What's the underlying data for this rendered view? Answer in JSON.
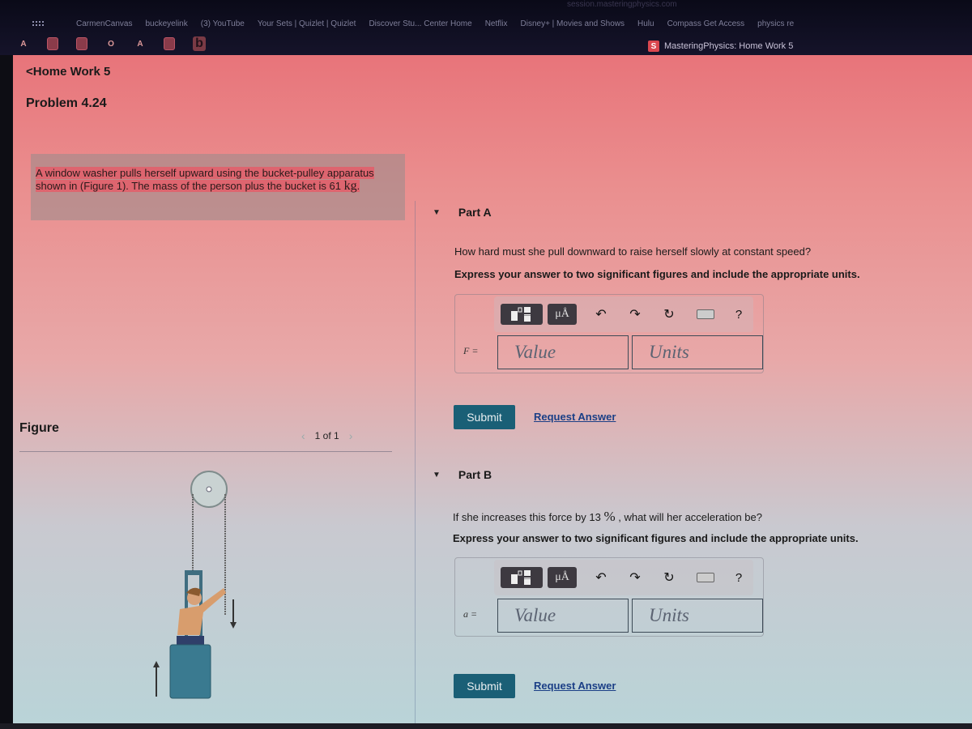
{
  "browser": {
    "url_partial": "session.masteringphysics.com",
    "bookmarks": [
      "CarmenCanvas",
      "buckeyelink",
      "(3) YouTube",
      "Your Sets | Quizlet | Quizlet",
      "Discover Stu... Center Home",
      "Netflix",
      "Disney+ | Movies and Shows",
      "Hulu",
      "Compass Get Access",
      "physics re"
    ],
    "pinned_tabs": [
      "A",
      "",
      "",
      "O",
      "A",
      "",
      "b"
    ],
    "active_tab_title": "MasteringPhysics: Home Work 5",
    "active_tab_icon": "mastering-logo"
  },
  "nav": {
    "back_label": "Home Work 5",
    "problem_title": "Problem 4.24"
  },
  "problem": {
    "text_before": "A window washer pulls herself upward using the bucket-pulley apparatus shown in (Figure 1). The mass of the person plus the bucket is 61 ",
    "unit": "kg",
    "text_after": "."
  },
  "figure": {
    "label": "Figure",
    "pager": "1 of 1",
    "prev_icon": "chevron-left-icon",
    "next_icon": "chevron-right-icon"
  },
  "toolbar": {
    "templates_icon": "templates-icon",
    "units_label": "μÅ",
    "undo_icon": "undo-icon",
    "redo_icon": "redo-icon",
    "reset_icon": "reset-icon",
    "keyboard_icon": "keyboard-icon",
    "help_label": "?"
  },
  "parts": [
    {
      "label": "Part A",
      "question": "How hard must she pull downward to raise herself slowly at constant speed?",
      "instruction": "Express your answer to two significant figures and include the appropriate units.",
      "variable": "F =",
      "value_placeholder": "Value",
      "units_placeholder": "Units",
      "submit_label": "Submit",
      "request_label": "Request Answer"
    },
    {
      "label": "Part B",
      "question_before": "If she increases this force by 13 ",
      "question_unit": "%",
      "question_after": " , what will her acceleration be?",
      "instruction": "Express your answer to two significant figures and include the appropriate units.",
      "variable": "a =",
      "value_placeholder": "Value",
      "units_placeholder": "Units",
      "submit_label": "Submit",
      "request_label": "Request Answer"
    }
  ]
}
